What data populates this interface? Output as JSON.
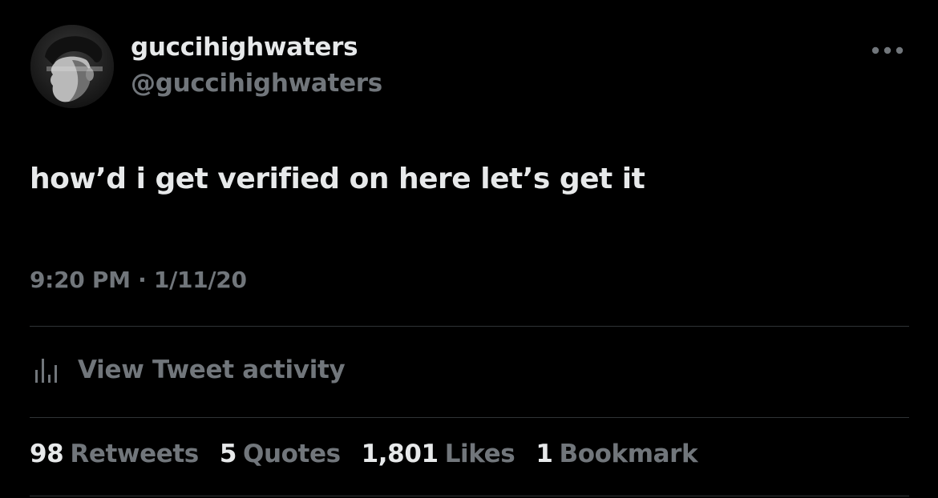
{
  "author": {
    "display_name": "guccihighwaters",
    "handle": "@guccihighwaters"
  },
  "tweet": {
    "text": "how’d i get verified on here let’s get it",
    "timestamp": "9:20 PM · 1/11/20"
  },
  "activity": {
    "label": "View Tweet activity",
    "icon": "bar-chart-icon"
  },
  "stats": {
    "retweets": {
      "count": "98",
      "label": "Retweets"
    },
    "quotes": {
      "count": "5",
      "label": "Quotes"
    },
    "likes": {
      "count": "1,801",
      "label": "Likes"
    },
    "bookmarks": {
      "count": "1",
      "label": "Bookmark"
    }
  },
  "colors": {
    "background": "#000000",
    "primary_text": "#e7e9ea",
    "secondary_text": "#71767b",
    "divider": "#2f3336"
  }
}
